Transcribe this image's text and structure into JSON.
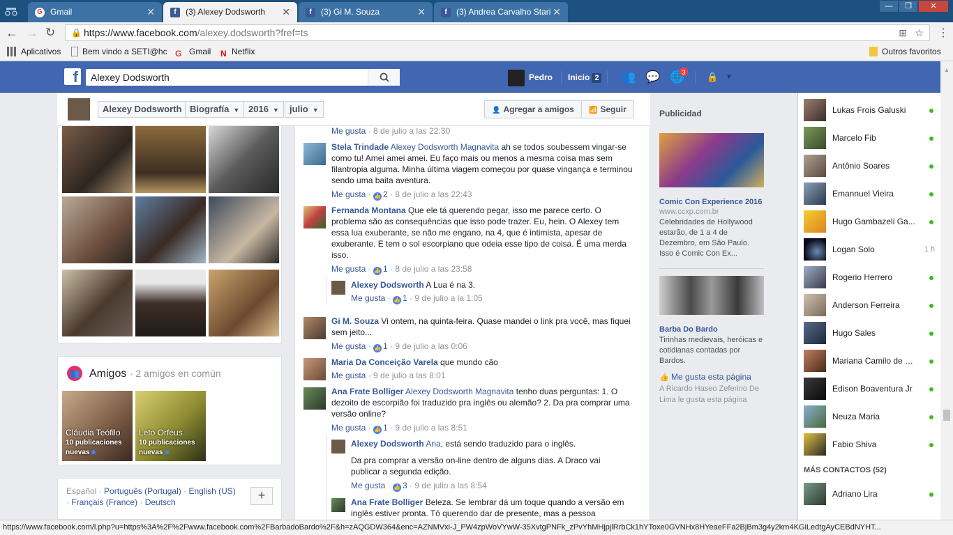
{
  "browser": {
    "tabs": [
      {
        "label": "Gmail"
      },
      {
        "label": "(3) Alexey Dodsworth"
      },
      {
        "label": "(3) Gi M. Souza"
      },
      {
        "label": "(3) Andrea Carvalho Stari"
      }
    ],
    "url_host": "https://www.facebook.com",
    "url_path": "/alexey.dodsworth?fref=ts",
    "bookmarks": [
      "Aplicativos",
      "Bem vindo a SETI@hc",
      "Gmail",
      "Netflix"
    ],
    "other_bookmarks": "Outros favoritos",
    "status_url": "https://www.facebook.com/l.php?u=https%3A%2F%2Fwww.facebook.com%2FBarbadoBardo%2F&h=zAQGDW364&enc=AZNMVxi-J_PW4zpWoVYwW-35XvtgPNFk_zPvYhMHjpjlRrbCk1hYToxe0GVNHx8HYeaeFFa2BjBm3g4y2km4KGiLedtgAyCEBdNYHT..."
  },
  "fb": {
    "search_value": "Alexey Dodsworth",
    "user_name": "Pedro",
    "home_label": "Inicio",
    "home_count": "2",
    "notif_count": "3"
  },
  "timeline_header": {
    "name": "Alexey Dodsworth",
    "section": "Biografía",
    "year": "2016",
    "month": "julio",
    "add_friend": "Agregar a amigos",
    "follow": "Seguir"
  },
  "friends": {
    "title": "Amigos",
    "subtitle": "· 2 amigos en común",
    "cards": [
      {
        "name": "Cláudia Teófilo",
        "posts": "10 publicaciones",
        "new": "nuevas"
      },
      {
        "name": "Leto Orfeus",
        "posts": "10 publicaciones",
        "new": "nuevas"
      }
    ]
  },
  "languages": {
    "current": "Español",
    "others": [
      "Português (Portugal)",
      "English (US)",
      "Français (France)",
      "Deutsch"
    ],
    "plus": "+"
  },
  "comments": {
    "top_meta": {
      "like": "Me gusta",
      "time": "8 de julio a las 22:30"
    },
    "items": [
      {
        "author": "Stela Trindade",
        "tag": "Alexey Dodsworth Magnavita",
        "text": " ah se todos soubessem vingar-se como tu! Amei amei amei. Eu faço mais ou menos a mesma coisa mas sem filantropia alguma. Minha última viagem começou por quase vingança e terminou sendo uma baita aventura.",
        "like": "Me gusta",
        "likes": "2",
        "time": "8 de julio a las 22:43"
      },
      {
        "author": "Fernanda Montana",
        "tag": "",
        "text": " Que ele tá querendo pegar, isso me parece certo. O problema são as consequências que isso pode trazer. Eu, hein. O Alexey tem essa lua exuberante, se não me engano, na 4, que é intimista, apesar de exuberante. E tem o sol escorpiano que odeia esse tipo de coisa. É uma merda isso.",
        "like": "Me gusta",
        "likes": "1",
        "time": "8 de julio a las 23:58"
      },
      {
        "author": "Alexey Dodsworth",
        "tag": "",
        "text": " A Lua é na 3.",
        "like": "Me gusta",
        "likes": "1",
        "time": "9 de julio a la 1:05"
      },
      {
        "author": "Gi M. Souza",
        "tag": "",
        "text": " Vi ontem, na quinta-feira. Quase mandei o link pra você, mas fiquei sem jeito...",
        "like": "Me gusta",
        "likes": "1",
        "time": "9 de julio a las 0:06"
      },
      {
        "author": "Maria Da Conceição Varela",
        "tag": "",
        "text": " que mundo cão",
        "like": "Me gusta",
        "likes": "",
        "time": "9 de julio a las 8:01"
      },
      {
        "author": "Ana Frate Bolliger",
        "tag": "Alexey Dodsworth Magnavita",
        "text": " tenho duas perguntas: 1. O dezoito de escorpião foi traduzido pra inglês ou alemão? 2. Da pra comprar uma versão online?",
        "like": "Me gusta",
        "likes": "1",
        "time": "9 de julio a las 8:51"
      },
      {
        "author": "Alexey Dodsworth",
        "tag": "Ana",
        "text": ", está sendo traduzido para o inglês.",
        "text2": "Da pra comprar a versão on-line dentro de alguns dias. A Draco vai publicar a segunda edição.",
        "like": "Me gusta",
        "likes": "3",
        "time": "9 de julio a las 8:54"
      },
      {
        "author": "Ana Frate Bolliger",
        "tag": "",
        "text": " Beleza. Se lembrar dá um toque quando a versão em inglês estiver pronta. Tô querendo dar de presente, mas a pessoa"
      }
    ]
  },
  "ads": {
    "header": "Publicidad",
    "ad1": {
      "title": "Comic Con Experience 2016",
      "domain": "www.ccxp.com.br",
      "text": "Celebridades de Hollywood estarão, de 1 a 4 de Dezembro, em São Paulo. Isso é Comic Con Ex..."
    },
    "ad2": {
      "title": "Barba Do Bardo",
      "text": "Tirinhas medievais, heróicas e cotidianas contadas por Bardos.",
      "like": "Me gusta esta página",
      "footer": "A Ricardo Haseo Zeferino De Lima le gusta esta página"
    }
  },
  "contacts": {
    "list": [
      {
        "name": "Lukas Frois Galuski",
        "status": "online"
      },
      {
        "name": "Marcelo Fib",
        "status": "online"
      },
      {
        "name": "Antônio Soares",
        "status": "online"
      },
      {
        "name": "Emannuel Vieira",
        "status": "online"
      },
      {
        "name": "Hugo Gambazeli Ga...",
        "status": "online"
      },
      {
        "name": "Logan Solo",
        "status": "1 h"
      },
      {
        "name": "Rogerio Herrero",
        "status": "online"
      },
      {
        "name": "Anderson Ferreira",
        "status": "online"
      },
      {
        "name": "Hugo Sales",
        "status": "online"
      },
      {
        "name": "Mariana Camilo de S...",
        "status": "online"
      },
      {
        "name": "Edison Boaventura Jr",
        "status": "online"
      },
      {
        "name": "Neuza Maria",
        "status": "online"
      },
      {
        "name": "Fabio Shiva",
        "status": "online"
      }
    ],
    "more_label": "MÁS CONTACTOS (52)",
    "more": [
      {
        "name": "Adriano Lira",
        "status": "online"
      }
    ]
  }
}
